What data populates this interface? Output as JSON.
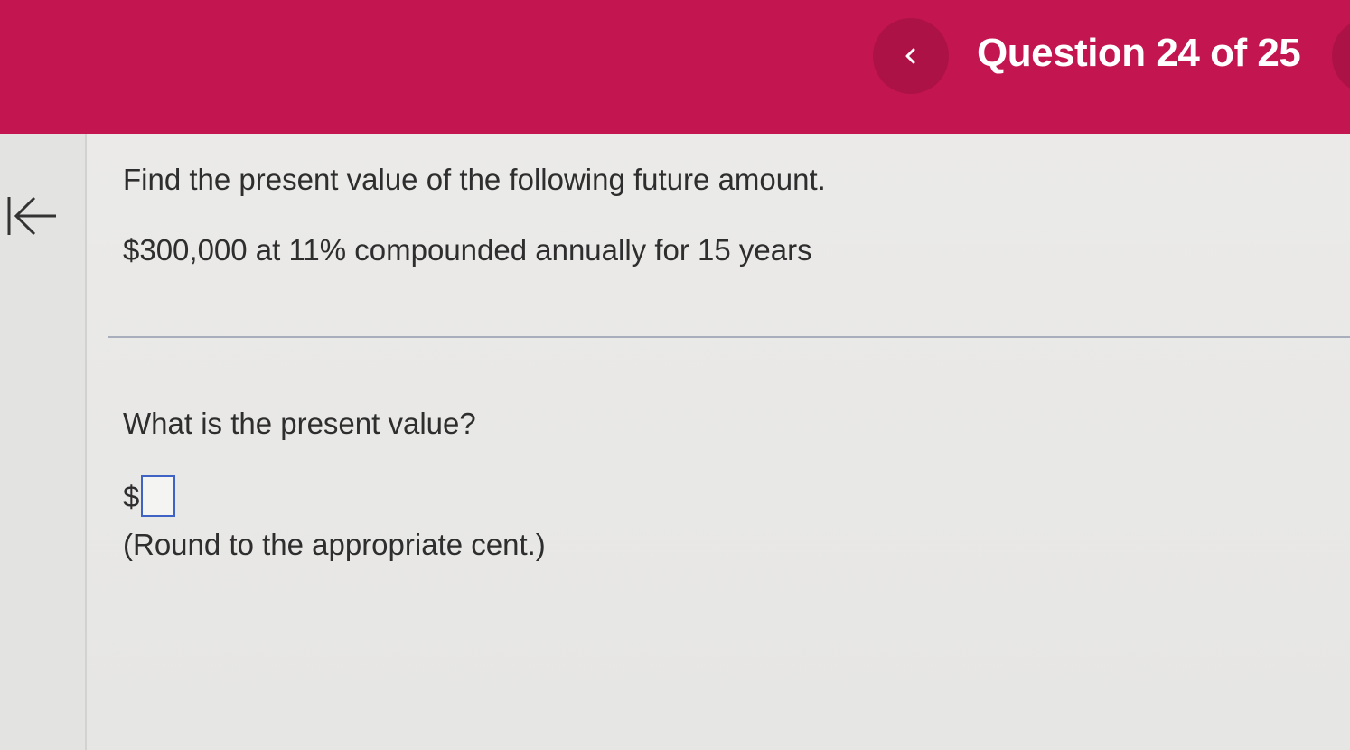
{
  "header": {
    "question_counter": "Question 24 of 25",
    "background_color": "#c3154f",
    "prev_icon": "chevron-left-icon"
  },
  "sidebar": {
    "collapse_icon": "collapse-left-arrow-icon"
  },
  "question": {
    "prompt": "Find the present value of the following future amount.",
    "problem": "$300,000 at 11% compounded annually for 15 years",
    "sub_question": "What is the present value?",
    "currency_symbol": "$",
    "answer_value": "",
    "rounding_note": "(Round to the appropriate cent.)"
  }
}
